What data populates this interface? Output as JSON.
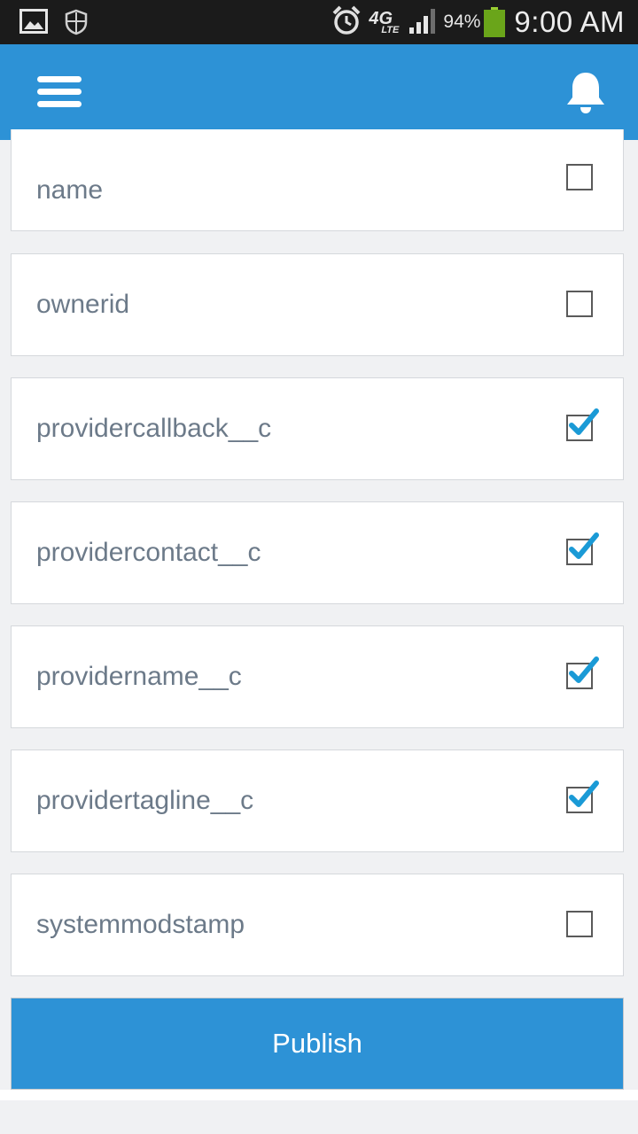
{
  "status_bar": {
    "icons_left": [
      "image-icon",
      "shield-icon"
    ],
    "icons_right": [
      "alarm-icon",
      "4g-lte-icon",
      "signal-icon",
      "battery-icon"
    ],
    "network": "4G",
    "network_sub": "LTE",
    "battery_percent": "94%",
    "battery_level": 0.94,
    "time": "9:00 AM"
  },
  "app_bar": {
    "background_color": "#2d92d6",
    "menu_icon": "hamburger-menu-icon",
    "bell_icon": "bell-icon"
  },
  "fields": [
    {
      "label": "name",
      "checked": false
    },
    {
      "label": "ownerid",
      "checked": false
    },
    {
      "label": "providercallback__c",
      "checked": true
    },
    {
      "label": "providercontact__c",
      "checked": true
    },
    {
      "label": "providername__c",
      "checked": true
    },
    {
      "label": "providertagline__c",
      "checked": true
    },
    {
      "label": "systemmodstamp",
      "checked": false
    }
  ],
  "publish_label": "Publish",
  "colors": {
    "accent": "#2d92d6",
    "check": "#1a9ad6",
    "label_text": "#6c7a89"
  }
}
